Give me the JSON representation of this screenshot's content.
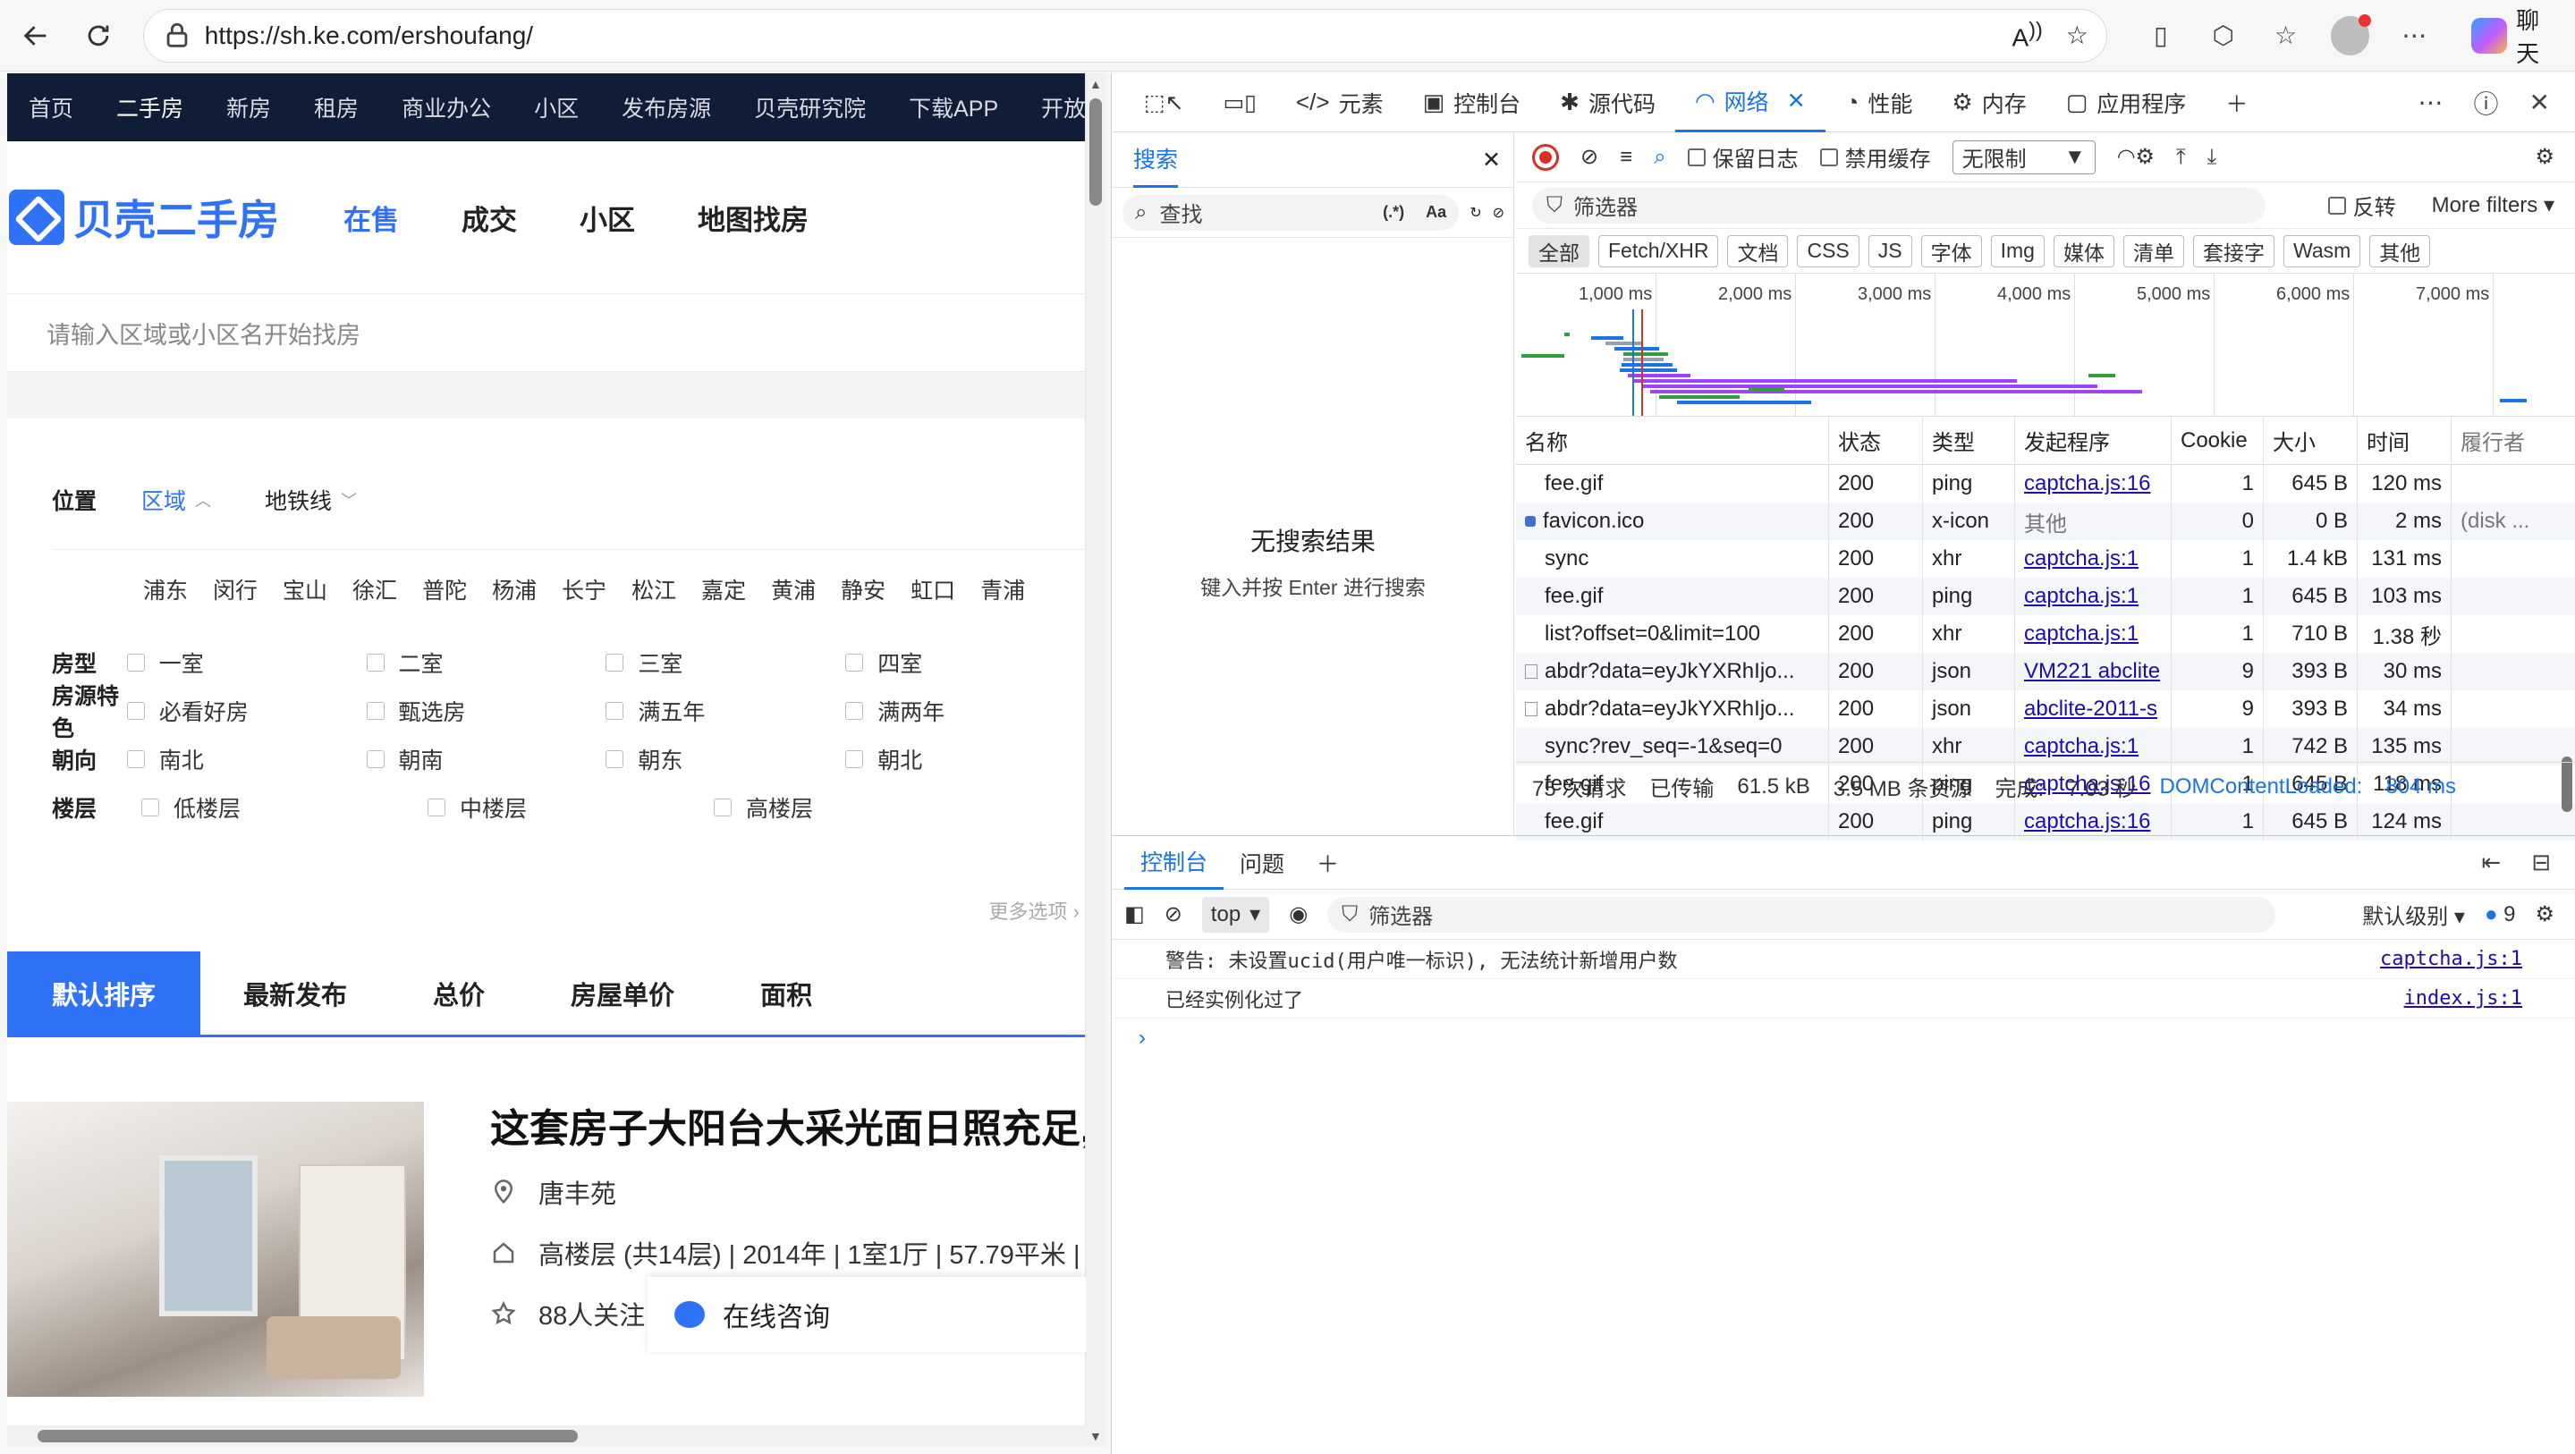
{
  "browser": {
    "url": "https://sh.ke.com/ershoufang/",
    "chat_label": "聊天"
  },
  "site": {
    "nav": [
      "首页",
      "二手房",
      "新房",
      "租房",
      "商业办公",
      "小区",
      "发布房源",
      "贝壳研究院",
      "下载APP",
      "开放平台"
    ],
    "nav_active": "二手房",
    "logo_text": "贝壳二手房",
    "brand_tabs": [
      "在售",
      "成交",
      "小区",
      "地图找房"
    ],
    "search_placeholder": "请输入区域或小区名开始找房",
    "filters": {
      "position_label": "位置",
      "region_label": "区域",
      "metro_label": "地铁线",
      "districts": [
        "浦东",
        "闵行",
        "宝山",
        "徐汇",
        "普陀",
        "杨浦",
        "长宁",
        "松江",
        "嘉定",
        "黄浦",
        "静安",
        "虹口",
        "青浦"
      ],
      "rows": [
        {
          "label": "房型",
          "options": [
            "一室",
            "二室",
            "三室",
            "四室"
          ]
        },
        {
          "label": "房源特色",
          "options": [
            "必看好房",
            "甄选房",
            "满五年",
            "满两年"
          ]
        },
        {
          "label": "朝向",
          "options": [
            "南北",
            "朝南",
            "朝东",
            "朝北"
          ]
        },
        {
          "label": "楼层",
          "options": [
            "低楼层",
            "中楼层",
            "高楼层"
          ]
        }
      ],
      "more_options": "更多选项"
    },
    "sort_tabs": [
      "默认排序",
      "最新发布",
      "总价",
      "房屋单价",
      "面积"
    ],
    "listing": {
      "title": "这套房子大阳台大采光面日照充足,",
      "community": "唐丰苑",
      "info": "高楼层 (共14层) | 2014年 | 1室1厅 | 57.79平米 |",
      "follow": "88人关注"
    },
    "consult_label": "在线咨询"
  },
  "devtools": {
    "tabs": [
      {
        "label": "元素",
        "icon": "code-icon"
      },
      {
        "label": "控制台",
        "icon": "console-icon"
      },
      {
        "label": "源代码",
        "icon": "bug-icon"
      },
      {
        "label": "网络",
        "icon": "wifi-icon"
      },
      {
        "label": "性能",
        "icon": "gauge-icon"
      },
      {
        "label": "内存",
        "icon": "gear-icon"
      },
      {
        "label": "应用程序",
        "icon": "app-icon"
      }
    ],
    "active_tab": "网络",
    "search_pane": {
      "tab_label": "搜索",
      "placeholder": "查找",
      "regex_label": "(.*)",
      "case_label": "Aa",
      "empty_title": "无搜索结果",
      "empty_hint": "键入并按 Enter 进行搜索"
    },
    "network": {
      "preserve_log": "保留日志",
      "disable_cache": "禁用缓存",
      "throttle": "无限制",
      "filter_placeholder": "筛选器",
      "invert": "反转",
      "more_filters": "More filters",
      "types": [
        "全部",
        "Fetch/XHR",
        "文档",
        "CSS",
        "JS",
        "字体",
        "Img",
        "媒体",
        "清单",
        "套接字",
        "Wasm",
        "其他"
      ],
      "timeline_ticks": [
        "1,000 ms",
        "2,000 ms",
        "3,000 ms",
        "4,000 ms",
        "5,000 ms",
        "6,000 ms",
        "7,000 ms"
      ],
      "columns": [
        "名称",
        "状态",
        "类型",
        "发起程序",
        "Cookie",
        "大小",
        "时间",
        "履行者"
      ],
      "rows": [
        {
          "name": "fee.gif",
          "status": "200",
          "type": "ping",
          "initiator": "captcha.js:16",
          "cookie": "1",
          "size": "645 B",
          "time": "120 ms",
          "fulfilled": ""
        },
        {
          "name": "favicon.ico",
          "status": "200",
          "type": "x-icon",
          "initiator": "其他",
          "cookie": "0",
          "size": "0 B",
          "time": "2 ms",
          "fulfilled": "(disk ..."
        },
        {
          "name": "sync",
          "status": "200",
          "type": "xhr",
          "initiator": "captcha.js:1",
          "cookie": "1",
          "size": "1.4 kB",
          "time": "131 ms",
          "fulfilled": ""
        },
        {
          "name": "fee.gif",
          "status": "200",
          "type": "ping",
          "initiator": "captcha.js:1",
          "cookie": "1",
          "size": "645 B",
          "time": "103 ms",
          "fulfilled": ""
        },
        {
          "name": "list?offset=0&limit=100",
          "status": "200",
          "type": "xhr",
          "initiator": "captcha.js:1",
          "cookie": "1",
          "size": "710 B",
          "time": "1.38 秒",
          "fulfilled": ""
        },
        {
          "name": "abdr?data=eyJkYXRhIjo...",
          "status": "200",
          "type": "json",
          "initiator": "VM221 abclite",
          "cookie": "9",
          "size": "393 B",
          "time": "30 ms",
          "fulfilled": ""
        },
        {
          "name": "abdr?data=eyJkYXRhIjo...",
          "status": "200",
          "type": "json",
          "initiator": "abclite-2011-s",
          "cookie": "9",
          "size": "393 B",
          "time": "34 ms",
          "fulfilled": ""
        },
        {
          "name": "sync?rev_seq=-1&seq=0",
          "status": "200",
          "type": "xhr",
          "initiator": "captcha.js:1",
          "cookie": "1",
          "size": "742 B",
          "time": "135 ms",
          "fulfilled": ""
        },
        {
          "name": "fee.gif",
          "status": "200",
          "type": "ping",
          "initiator": "captcha.js:16",
          "cookie": "1",
          "size": "645 B",
          "time": "118 ms",
          "fulfilled": ""
        },
        {
          "name": "fee.gif",
          "status": "200",
          "type": "ping",
          "initiator": "captcha.js:16",
          "cookie": "1",
          "size": "645 B",
          "time": "124 ms",
          "fulfilled": ""
        }
      ],
      "summary": {
        "requests": "75 次请求",
        "transferred": "已传输",
        "transferred_size": "61.5 kB",
        "resources": "3.5 MB 条资源",
        "finish_label": "完成:",
        "finish": "7.03 秒",
        "dcl": "DOMContentLoaded:",
        "dcl_time": "804 ms"
      }
    },
    "drawer": {
      "tabs": [
        "控制台",
        "问题"
      ],
      "context": "top",
      "filter_placeholder": "筛选器",
      "level": "默认级别",
      "issue_count": "9",
      "messages": [
        {
          "text": "警告: 未设置ucid(用户唯一标识), 无法统计新增用户数",
          "source": "captcha.js:1"
        },
        {
          "text": "已经实例化过了",
          "source": "index.js:1"
        }
      ]
    }
  }
}
